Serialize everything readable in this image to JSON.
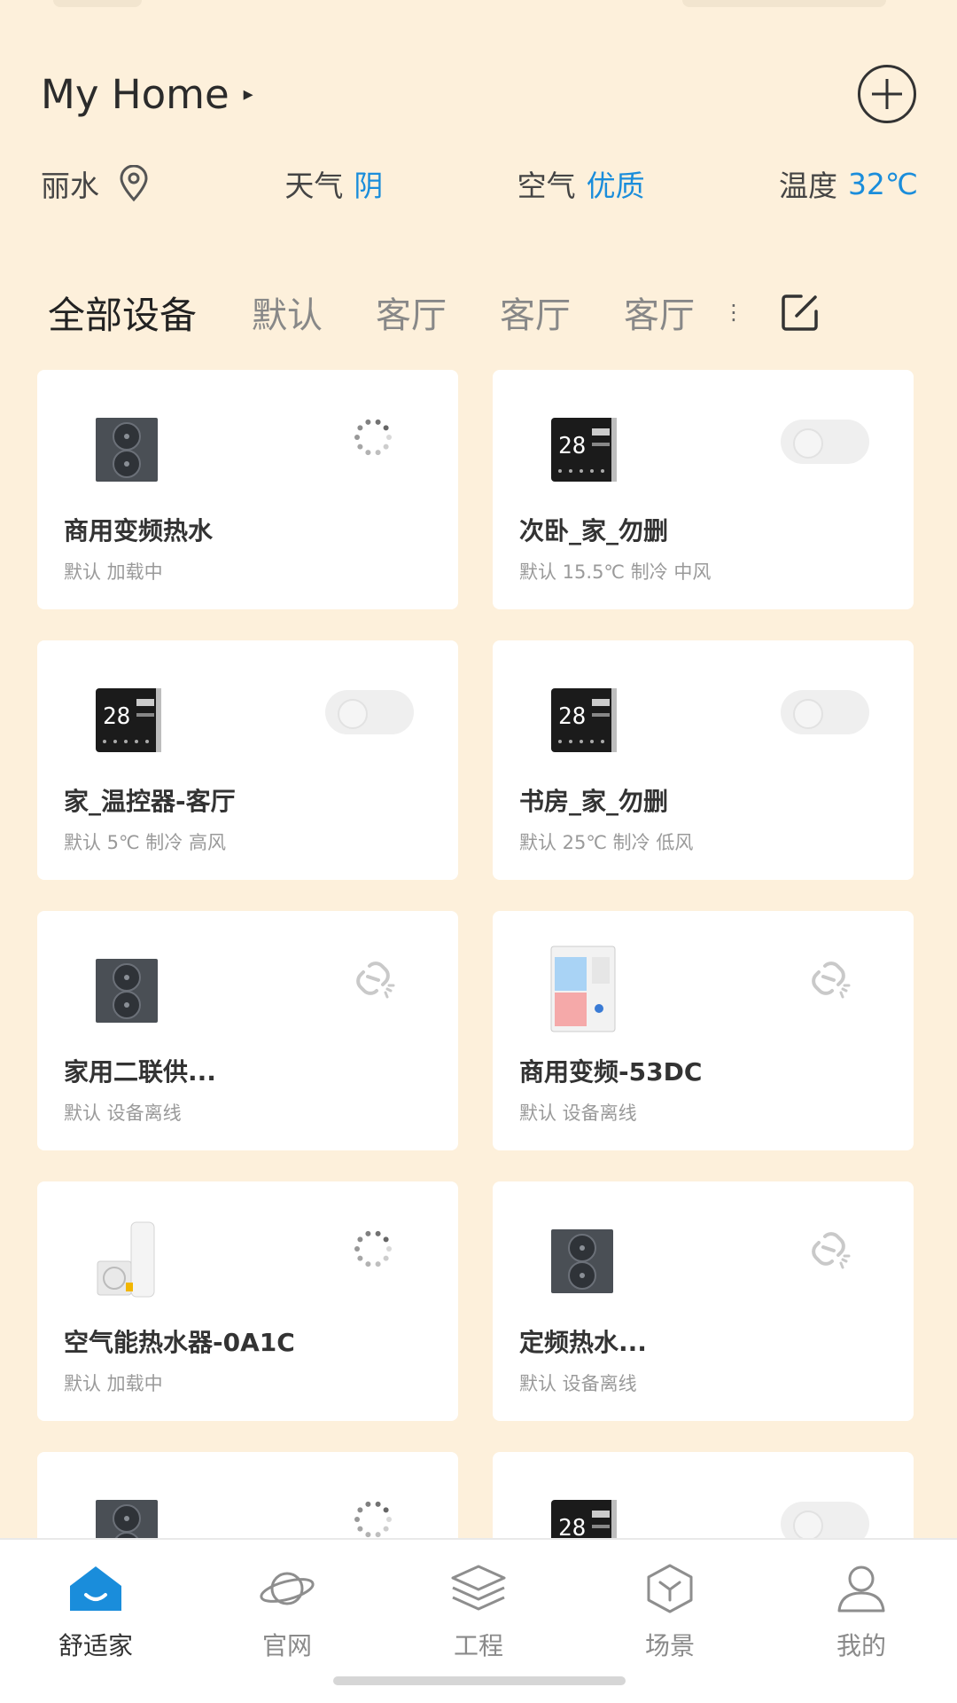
{
  "header": {
    "title": "My Home",
    "title_arrow": "▸"
  },
  "info": {
    "city": "丽水",
    "weather_label": "天气",
    "weather_value": "阴",
    "air_label": "空气",
    "air_value": "优质",
    "temp_label": "温度",
    "temp_value": "32℃"
  },
  "tabs": [
    "全部设备",
    "默认",
    "客厅",
    "客厅",
    "客厅"
  ],
  "tab_overflow": "⋮",
  "devices": [
    {
      "title": "商用变频热水",
      "sub": "默认 加载中",
      "image": "heat-pump-icon",
      "status": "loading"
    },
    {
      "title": "次卧_家_勿删",
      "sub": "默认 15.5℃ 制冷 中风",
      "image": "thermostat-icon",
      "status": "toggle-off"
    },
    {
      "title": "家_温控器-客厅",
      "sub": "默认 5℃ 制冷 高风",
      "image": "thermostat-icon",
      "status": "toggle-off"
    },
    {
      "title": "书房_家_勿删",
      "sub": "默认 25℃ 制冷 低风",
      "image": "thermostat-icon",
      "status": "toggle-off"
    },
    {
      "title": "家用二联供...",
      "sub": "默认 设备离线",
      "image": "heat-pump-icon",
      "status": "offline"
    },
    {
      "title": "商用变频-53DC",
      "sub": "默认 设备离线",
      "image": "cabinet-unit-icon",
      "status": "offline"
    },
    {
      "title": "空气能热水器-0A1C",
      "sub": "默认 加载中",
      "image": "water-heater-icon",
      "status": "loading"
    },
    {
      "title": "定频热水...",
      "sub": "默认 设备离线",
      "image": "heat-pump-icon",
      "status": "offline"
    },
    {
      "title": "",
      "sub": "",
      "image": "heat-pump-icon",
      "status": "loading"
    },
    {
      "title": "",
      "sub": "",
      "image": "thermostat-icon",
      "status": "toggle-off"
    }
  ],
  "thermostat_display": "28",
  "nav": [
    {
      "label": "舒适家",
      "icon": "home-icon",
      "active": true
    },
    {
      "label": "官网",
      "icon": "planet-icon",
      "active": false
    },
    {
      "label": "工程",
      "icon": "layers-icon",
      "active": false
    },
    {
      "label": "场景",
      "icon": "cube-icon",
      "active": false
    },
    {
      "label": "我的",
      "icon": "user-icon",
      "active": false
    }
  ],
  "colors": {
    "background": "#fdf0db",
    "accent": "#1a8ddb",
    "active_nav": "#1a8ddb"
  }
}
